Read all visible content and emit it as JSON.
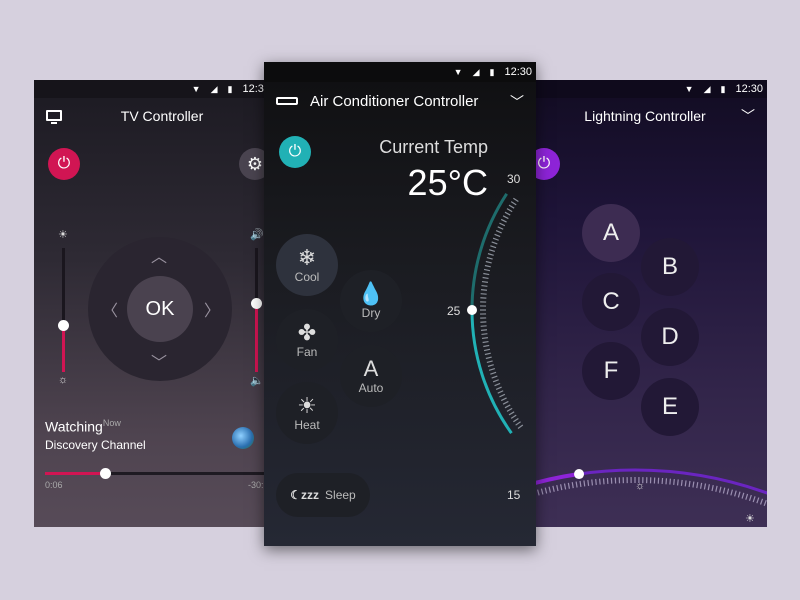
{
  "status_bar": {
    "time": "12:30"
  },
  "tv": {
    "title": "TV Controller",
    "ok_label": "OK",
    "brightness_level": 0.37,
    "volume_level": 0.55,
    "watching_label": "Watching",
    "watching_sup": "Now",
    "channel": "Discovery Channel",
    "progress": 0.26,
    "time_elapsed": "0:06",
    "time_remaining": "-30:",
    "accent": "#d11553"
  },
  "ac": {
    "title": "Air Conditioner Controller",
    "current_temp_label": "Current Temp",
    "current_temp": "25",
    "unit": "°C",
    "dial_min": "15",
    "dial_mid": "25",
    "dial_max": "30",
    "modes": [
      {
        "label": "Cool",
        "icon": "❄",
        "active": true
      },
      {
        "label": "Dry",
        "icon": "💧",
        "active": false
      },
      {
        "label": "Fan",
        "icon": "✤",
        "active": false
      },
      {
        "label": "Auto",
        "icon": "A",
        "active": false
      },
      {
        "label": "Heat",
        "icon": "☀",
        "active": false
      }
    ],
    "sleep_label": "Sleep",
    "sleep_icon": "☾zzz",
    "accent": "#21b1b5"
  },
  "lighting": {
    "title": "Lightning Controller",
    "scenes": [
      "A",
      "B",
      "C",
      "D",
      "F",
      "E"
    ],
    "active_scene": "A",
    "brightness_level": 0.3,
    "accent": "#8e24d8"
  }
}
